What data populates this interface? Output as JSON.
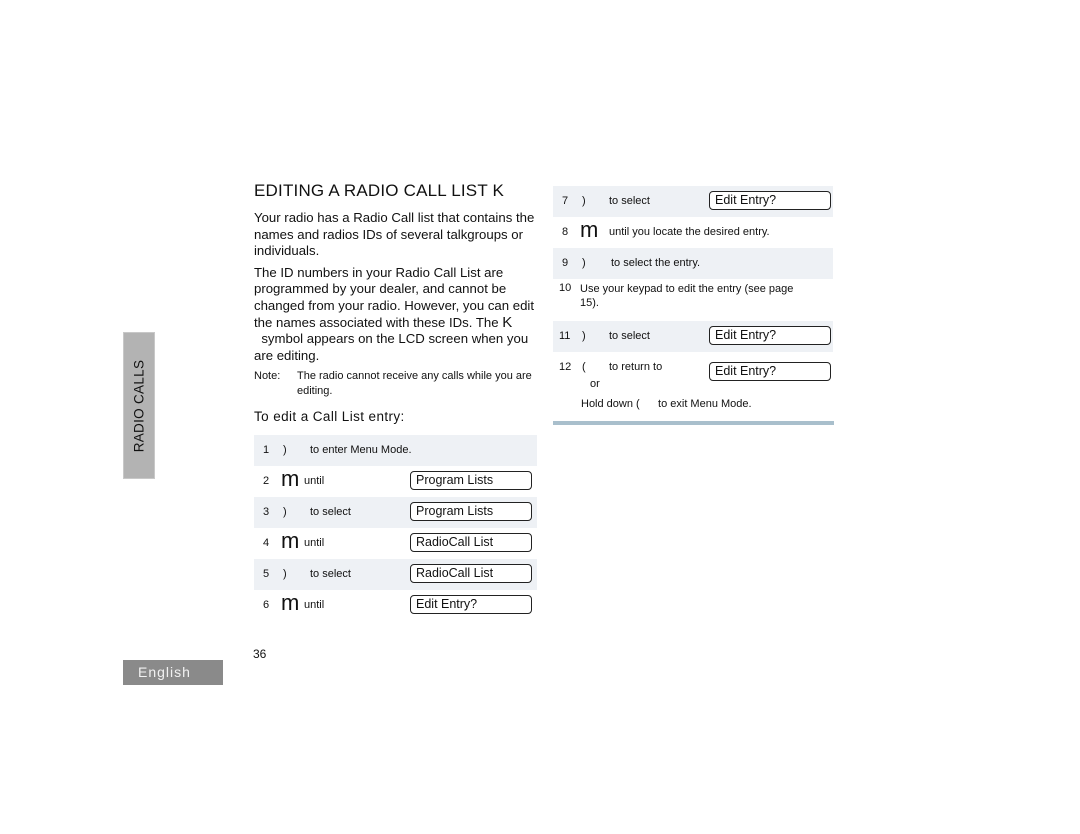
{
  "side_tab": {
    "label": "RADIO CALLS"
  },
  "language_tab": {
    "label": "English"
  },
  "page_number": "36",
  "section": {
    "title": "EDITING A RADIO CALL LIST K",
    "para1": "Your radio has a Radio Call list that contains the names and radios IDs of several talkgroups or individuals.",
    "para2_k": "K",
    "para2": "The ID numbers in your Radio Call List are programmed by your dealer, and cannot be changed from your radio. However, you can edit the names associated with these IDs. The",
    "para2_tail": "symbol appears on the LCD screen when you are editing.",
    "note_label": "Note:",
    "note_text": "The radio cannot receive any calls while you are editing.",
    "subheading": "To edit a Call List entry:"
  },
  "steps": [
    {
      "num": "1",
      "symbol": ")",
      "text": "to enter Menu Mode.",
      "display": null
    },
    {
      "num": "2",
      "symbol": "m",
      "text": "until",
      "display": "Program Lists"
    },
    {
      "num": "3",
      "symbol": ")",
      "text": "to select",
      "display": "Program Lists"
    },
    {
      "num": "4",
      "symbol": "m",
      "text": "until",
      "display": "RadioCall List"
    },
    {
      "num": "5",
      "symbol": ")",
      "text": "to select",
      "display": "RadioCall List"
    },
    {
      "num": "6",
      "symbol": "m",
      "text": "until",
      "display": "Edit Entry?"
    },
    {
      "num": "7",
      "symbol": ")",
      "text": "to select",
      "display": "Edit Entry?"
    },
    {
      "num": "8",
      "symbol": "m",
      "text": "until you locate the desired entry.",
      "display": null
    },
    {
      "num": "9",
      "symbol": ")",
      "text": "to select the entry.",
      "display": null
    },
    {
      "num": "10",
      "symbol": "",
      "text": "Use your keypad to edit the entry (see page 15).",
      "display": null
    },
    {
      "num": "11",
      "symbol": ")",
      "text": "to select",
      "display": "Edit Entry?"
    },
    {
      "num": "12",
      "symbol": "(",
      "text": "to return to",
      "display": "Edit Entry?",
      "or": "or",
      "alt": "Hold down (      to exit Menu Mode."
    }
  ]
}
